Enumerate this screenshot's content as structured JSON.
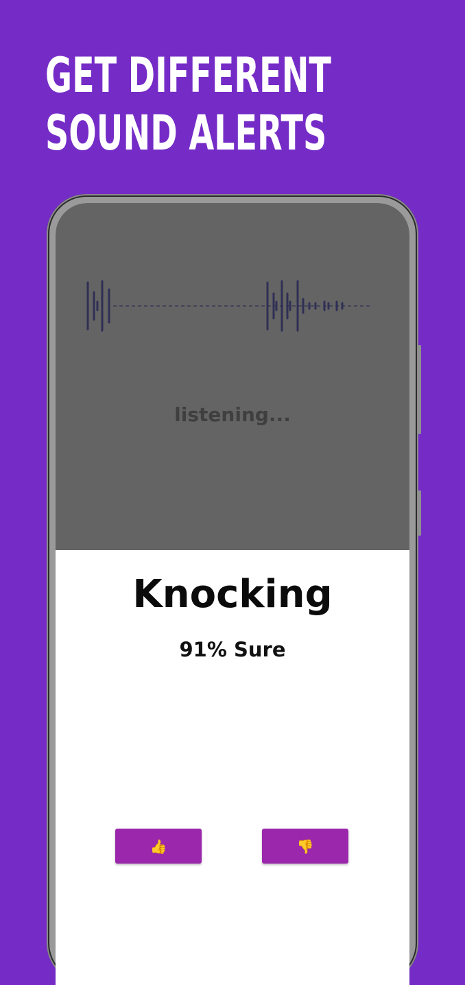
{
  "headline": {
    "line1": "GET DIFFERENT",
    "line2": "SOUND ALERTS"
  },
  "status": {
    "listening_text": "listening..."
  },
  "result": {
    "sound_name": "Knocking",
    "confidence_text": "91% Sure"
  },
  "feedback": {
    "thumbs_up_glyph": "👍",
    "thumbs_down_glyph": "👎"
  },
  "colors": {
    "background": "#752cc7",
    "screen_top": "#646464",
    "waveform": "#2f2f55",
    "button": "#9b27ac",
    "button_icon": "#f5c323"
  },
  "icons": {
    "thumbs_up": "thumbs-up-icon",
    "thumbs_down": "thumbs-down-icon"
  }
}
